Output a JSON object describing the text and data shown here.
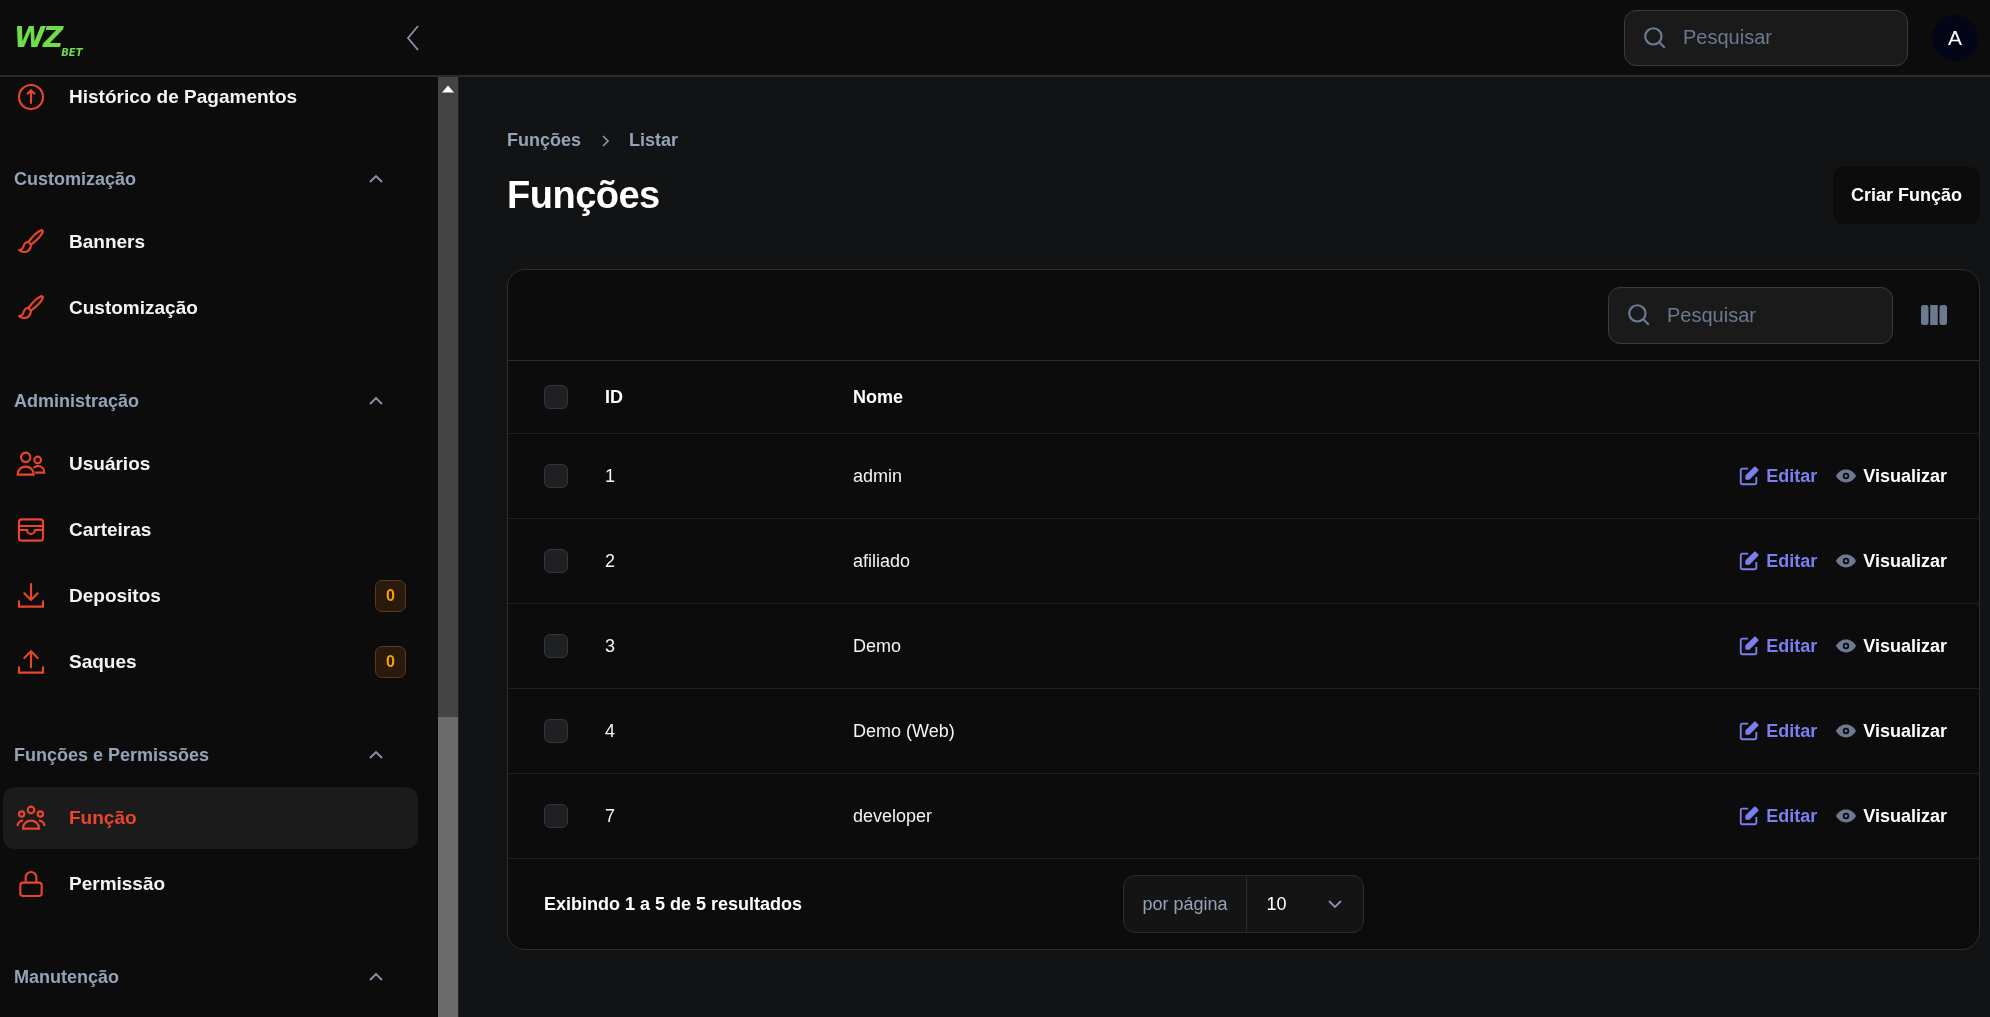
{
  "topbar": {
    "logo_text": "WZ",
    "logo_subtext": "BET",
    "search": {
      "placeholder": "Pesquisar"
    },
    "avatar": "A"
  },
  "sidebar": {
    "clipped_item": {
      "label": "Histórico de Pagamentos",
      "kind": "payments"
    },
    "sections": [
      {
        "title": "Customização",
        "expanded": true,
        "items": [
          {
            "label": "Banners",
            "kind": "brush",
            "selected": false
          },
          {
            "label": "Customização",
            "kind": "brush",
            "selected": false
          }
        ]
      },
      {
        "title": "Administração",
        "expanded": true,
        "items": [
          {
            "label": "Usuários",
            "kind": "users",
            "selected": false
          },
          {
            "label": "Carteiras",
            "kind": "wallet",
            "selected": false
          },
          {
            "label": "Depositos",
            "kind": "download",
            "selected": false,
            "badge": "0"
          },
          {
            "label": "Saques",
            "kind": "upload",
            "selected": false,
            "badge": "0"
          }
        ]
      },
      {
        "title": "Funções e Permissões",
        "expanded": true,
        "items": [
          {
            "label": "Função",
            "kind": "group",
            "selected": true
          },
          {
            "label": "Permissão",
            "kind": "lock",
            "selected": false
          }
        ]
      },
      {
        "title": "Manutenção",
        "expanded": true
      }
    ]
  },
  "breadcrumb": [
    "Funções",
    "Listar"
  ],
  "page_title": "Funções",
  "create_button": "Criar Função",
  "table": {
    "search": {
      "placeholder": "Pesquisar"
    },
    "columns": [
      "ID",
      "Nome"
    ],
    "header_checked": false,
    "rows": [
      {
        "id": "1",
        "name": "admin",
        "checked": false,
        "actions": [
          "Editar",
          "Visualizar"
        ]
      },
      {
        "id": "2",
        "name": "afiliado",
        "checked": false,
        "actions": [
          "Editar",
          "Visualizar"
        ]
      },
      {
        "id": "3",
        "name": "Demo",
        "checked": false,
        "actions": [
          "Editar",
          "Visualizar"
        ]
      },
      {
        "id": "4",
        "name": "Demo (Web)",
        "checked": false,
        "actions": [
          "Editar",
          "Visualizar"
        ]
      },
      {
        "id": "7",
        "name": "developer",
        "checked": false,
        "actions": [
          "Editar",
          "Visualizar"
        ]
      }
    ],
    "summary": "Exibindo 1 a 5 de 5 resultados",
    "per_page_label": "por página",
    "per_page_value": "10"
  }
}
